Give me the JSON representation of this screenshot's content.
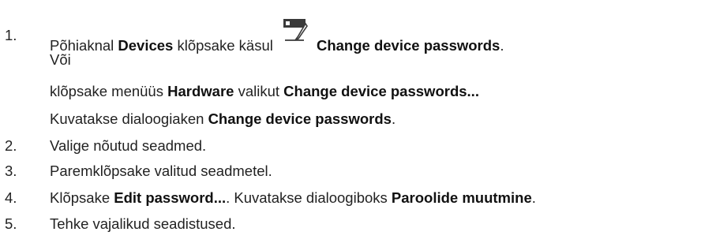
{
  "steps": [
    {
      "num": "1.",
      "parts": {
        "a": "Põhiaknal ",
        "b1": "Devices",
        "c": " klõpsake käsul ",
        "icon": "change-device-passwords-icon",
        "b2": "Change device passwords",
        "d": "."
      },
      "or": "Või",
      "line3": {
        "a": "klõpsake menüüs ",
        "b1": "Hardware",
        "c": " valikut ",
        "b2": "Change device passwords..."
      },
      "line4": {
        "a": "Kuvatakse dialoogiaken ",
        "b1": "Change device passwords",
        "c": "."
      }
    },
    {
      "num": "2.",
      "text": "Valige nõutud seadmed."
    },
    {
      "num": "3.",
      "text": "Paremklõpsake valitud seadmetel."
    },
    {
      "num": "4.",
      "parts": {
        "a": "Klõpsake ",
        "b1": "Edit password...",
        "c": ". Kuvatakse dialoogiboks ",
        "b2": "Paroolide muutmine",
        "d": "."
      }
    },
    {
      "num": "5.",
      "text": "Tehke vajalikud seadistused."
    }
  ]
}
